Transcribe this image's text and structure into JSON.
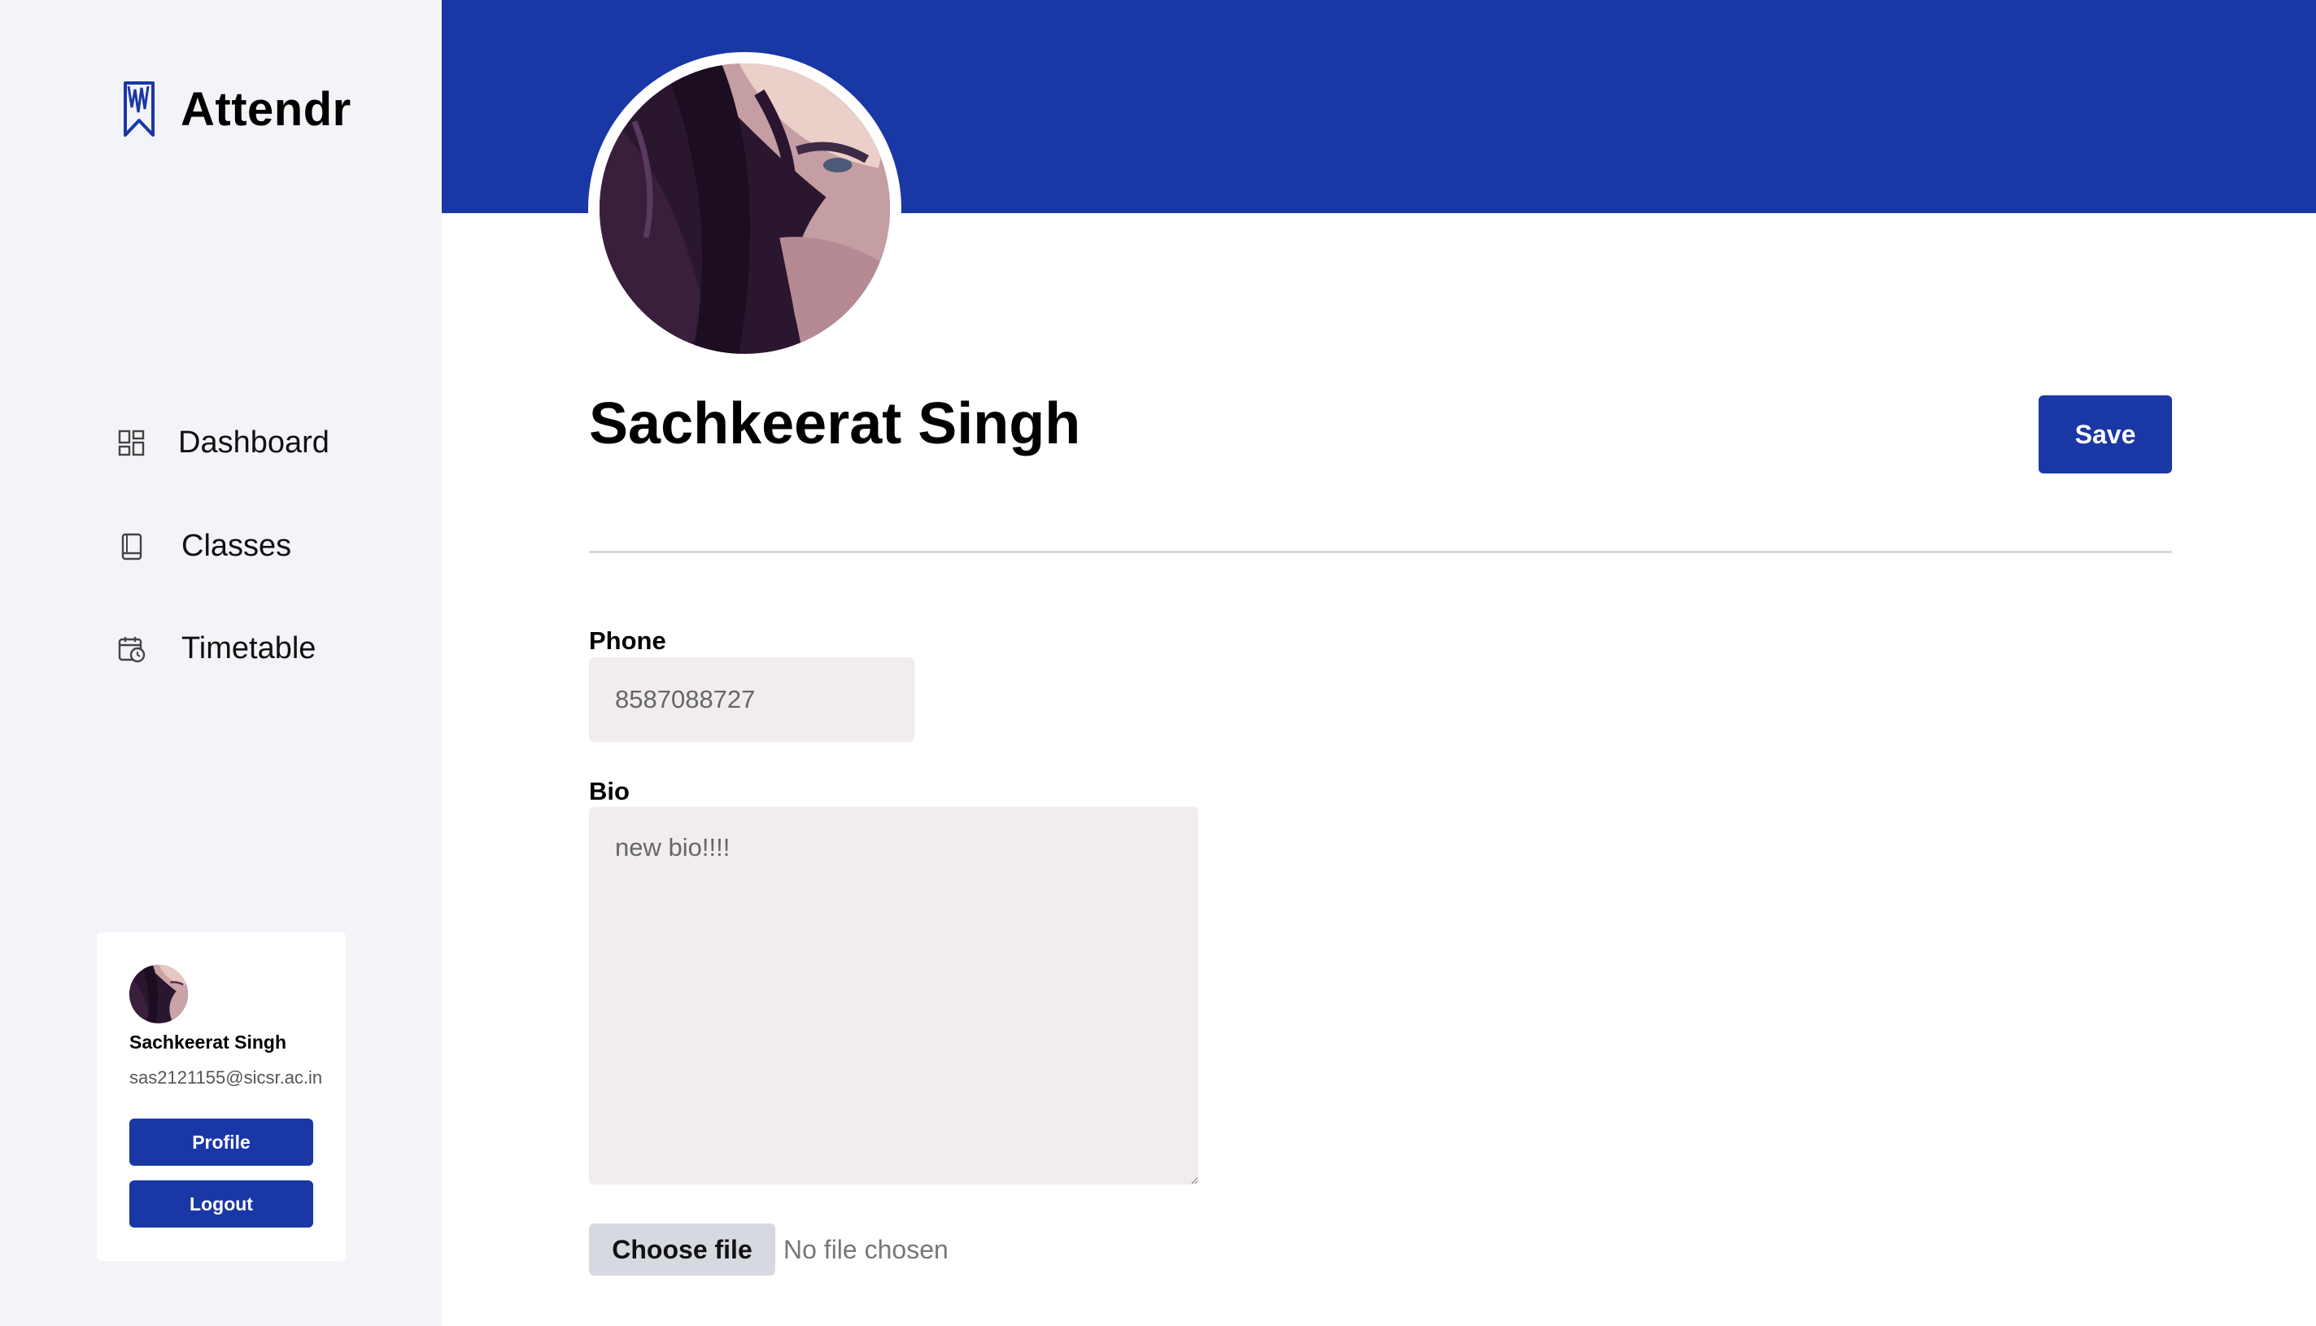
{
  "app": {
    "name": "Attendr"
  },
  "sidebar": {
    "items": [
      {
        "label": "Dashboard",
        "icon": "dashboard-grid-icon"
      },
      {
        "label": "Classes",
        "icon": "book-icon"
      },
      {
        "label": "Timetable",
        "icon": "calendar-clock-icon"
      }
    ],
    "user_card": {
      "name": "Sachkeerat Singh",
      "email": "sas2121155@sicsr.ac.in",
      "profile_label": "Profile",
      "logout_label": "Logout"
    }
  },
  "profile": {
    "name": "Sachkeerat Singh",
    "save_label": "Save",
    "phone": {
      "label": "Phone",
      "value": "8587088727"
    },
    "bio": {
      "label": "Bio",
      "value": "new bio!!!!"
    },
    "file": {
      "button_label": "Choose file",
      "status": "No file chosen"
    }
  },
  "colors": {
    "accent": "#1a37a6",
    "sidebar_bg": "#f3f4f8",
    "input_bg": "#f1eded"
  }
}
